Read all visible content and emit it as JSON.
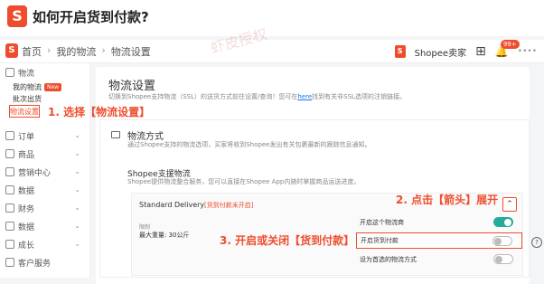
{
  "title": {
    "text": "如何开启货到付款?"
  },
  "topnav": {
    "breadcrumb": [
      "首页",
      "我的物流",
      "物流设置"
    ],
    "shop_label": "Shopee卖家",
    "notification_count": "99+",
    "user_name": "••••"
  },
  "sidebar": {
    "logistics": "物流",
    "sub_items": [
      {
        "label": "我的物流",
        "badge": "New"
      },
      {
        "label": "批次出货"
      }
    ],
    "active_item": "物流设置",
    "items": [
      "订单",
      "商品",
      "营销中心",
      "数据",
      "财务",
      "数据",
      "成长",
      "客户服务"
    ]
  },
  "annotations": {
    "step1": "1. 选择【物流设置】",
    "step2": "2. 点击【箭头】展开",
    "step3": "3. 开启或关闭【货到付款】"
  },
  "main": {
    "title": "物流设置",
    "description_prefix": "切换到Shopee支持物流（SSL）的送货方式前往设置/查询！您可在",
    "description_link": "here",
    "description_suffix": "找到有关非SSL选项的注销链接。"
  },
  "method": {
    "title": "物流方式",
    "description": "通过Shopee支持的物流选项，买家将收到Shopee发出有关包裹最新的跟踪信息通知。",
    "support_title": "Shopee支援物流",
    "support_desc": "Shopee提供物流整合服务，您可以直接在Shopee App内随时掌握商品运送进度。",
    "delivery_name": "Standard Delivery",
    "cod_status": "[货到付款未开启]",
    "weight_label": "限制",
    "weight_value": "最大重量: 30公斤",
    "options": [
      {
        "label": "开启这个物流商",
        "on": true
      },
      {
        "label": "开启货到付款",
        "on": false
      },
      {
        "label": "设为首选的物流方式",
        "on": false
      }
    ]
  },
  "watermark": "虾皮授权",
  "colors": {
    "brand": "#ee4d2d",
    "toggle_on": "#26aa99"
  }
}
